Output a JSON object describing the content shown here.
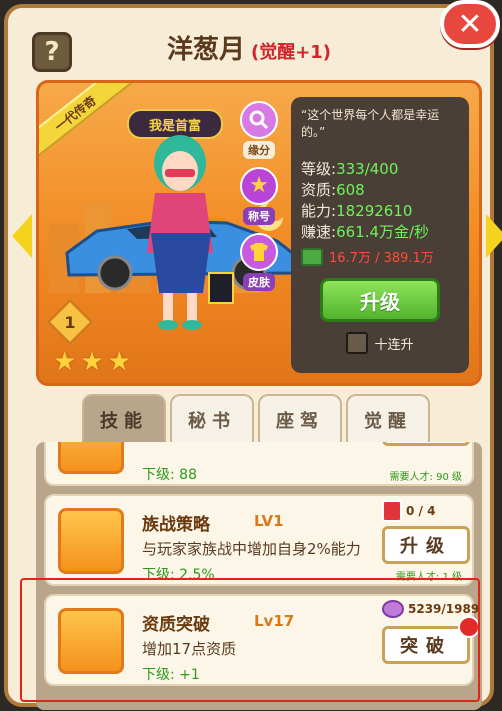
{
  "header": {
    "help_label": "?",
    "name": "洋葱月",
    "awaken": "(觉醒+1)",
    "close_label": "✕"
  },
  "character": {
    "ribbon": "一代传奇",
    "title_badge": "我是首富",
    "side_buttons": [
      {
        "label": "缘分",
        "icon": "magnifier-icon",
        "color": "#d77ae6"
      },
      {
        "label": "称号",
        "icon": "star-icon",
        "color": "#b845d8"
      },
      {
        "label": "皮肤",
        "icon": "shirt-icon",
        "color": "#c75ae0"
      }
    ],
    "level_badge": "1",
    "stars": 3,
    "quote": "“这个世界每个人都是幸运的。”",
    "stats": [
      {
        "label": "等级:",
        "value": "333/400"
      },
      {
        "label": "资质:",
        "value": "608"
      },
      {
        "label": "能力:",
        "value": "18292610"
      },
      {
        "label": "赚速:",
        "value": "661.4万金/秒"
      }
    ],
    "cash": "16.7万 / 389.1万",
    "upgrade_label": "升级",
    "ten_label": "十连升"
  },
  "tabs": [
    {
      "label": "技能",
      "active": true
    },
    {
      "label": "秘书",
      "active": false
    },
    {
      "label": "座驾",
      "active": false
    },
    {
      "label": "觉醒",
      "active": false
    }
  ],
  "skills": [
    {
      "next": "下级: 88",
      "req": "需要人才: 90 级"
    },
    {
      "name": "族战策略",
      "lv": "LV1",
      "desc": "与玩家家族战中增加自身2%能力",
      "next": "下级: 2.5%",
      "req": "需要人才: 1 级",
      "button": "升级",
      "cost": "0 / 4"
    },
    {
      "name": "资质突破",
      "lv": "Lv17",
      "desc": "增加17点资质",
      "next": "下级: +1",
      "button": "突破",
      "cost": "5239/1989"
    }
  ]
}
